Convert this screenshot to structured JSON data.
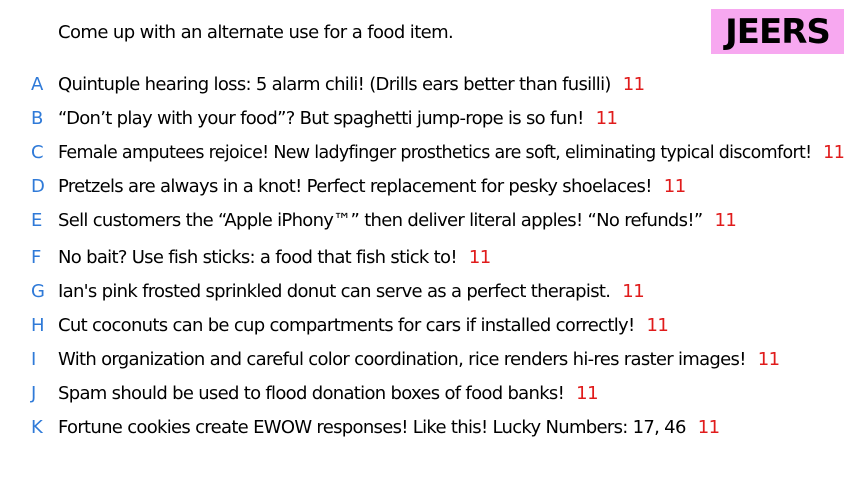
{
  "prompt": "Come up with an alternate use for a food item.",
  "badge": {
    "label": "JEERS",
    "background": "#f7a8f0",
    "color": "#000000"
  },
  "colors": {
    "letter": "#2f7ad8",
    "votes": "#e01b1b"
  },
  "entries": [
    {
      "letter": "A",
      "text": "Quintuple hearing loss: 5 alarm chili! (Drills ears better than fusilli)",
      "votes": "11"
    },
    {
      "letter": "B",
      "text": "“Don’t play with your food”? But spaghetti jump-rope is so fun!",
      "votes": "11"
    },
    {
      "letter": "C",
      "text": "Female amputees rejoice! New ladyfinger prosthetics are soft, eliminating typical discomfort!",
      "votes": "11"
    },
    {
      "letter": "D",
      "text": "Pretzels are always in a knot! Perfect replacement for pesky shoelaces!",
      "votes": "11"
    },
    {
      "letter": "E",
      "text": "Sell customers the “Apple iPhony™” then deliver literal apples! “No refunds!”",
      "votes": "11"
    },
    {
      "letter": "F",
      "text": "No bait? Use fish sticks: a food that fish stick to!",
      "votes": "11"
    },
    {
      "letter": "G",
      "text": "Ian's pink frosted sprinkled donut can serve as a perfect therapist.",
      "votes": "11"
    },
    {
      "letter": "H",
      "text": "Cut coconuts can be cup compartments for cars if installed correctly!",
      "votes": "11"
    },
    {
      "letter": "I",
      "text": "With organization and careful color coordination, rice renders hi-res raster images!",
      "votes": "11"
    },
    {
      "letter": "J",
      "text": "Spam should be used to flood donation boxes of food banks!",
      "votes": "11"
    },
    {
      "letter": "K",
      "text": "Fortune cookies create EWOW responses! Like this! Lucky Numbers: 17, 46",
      "votes": "11"
    }
  ]
}
